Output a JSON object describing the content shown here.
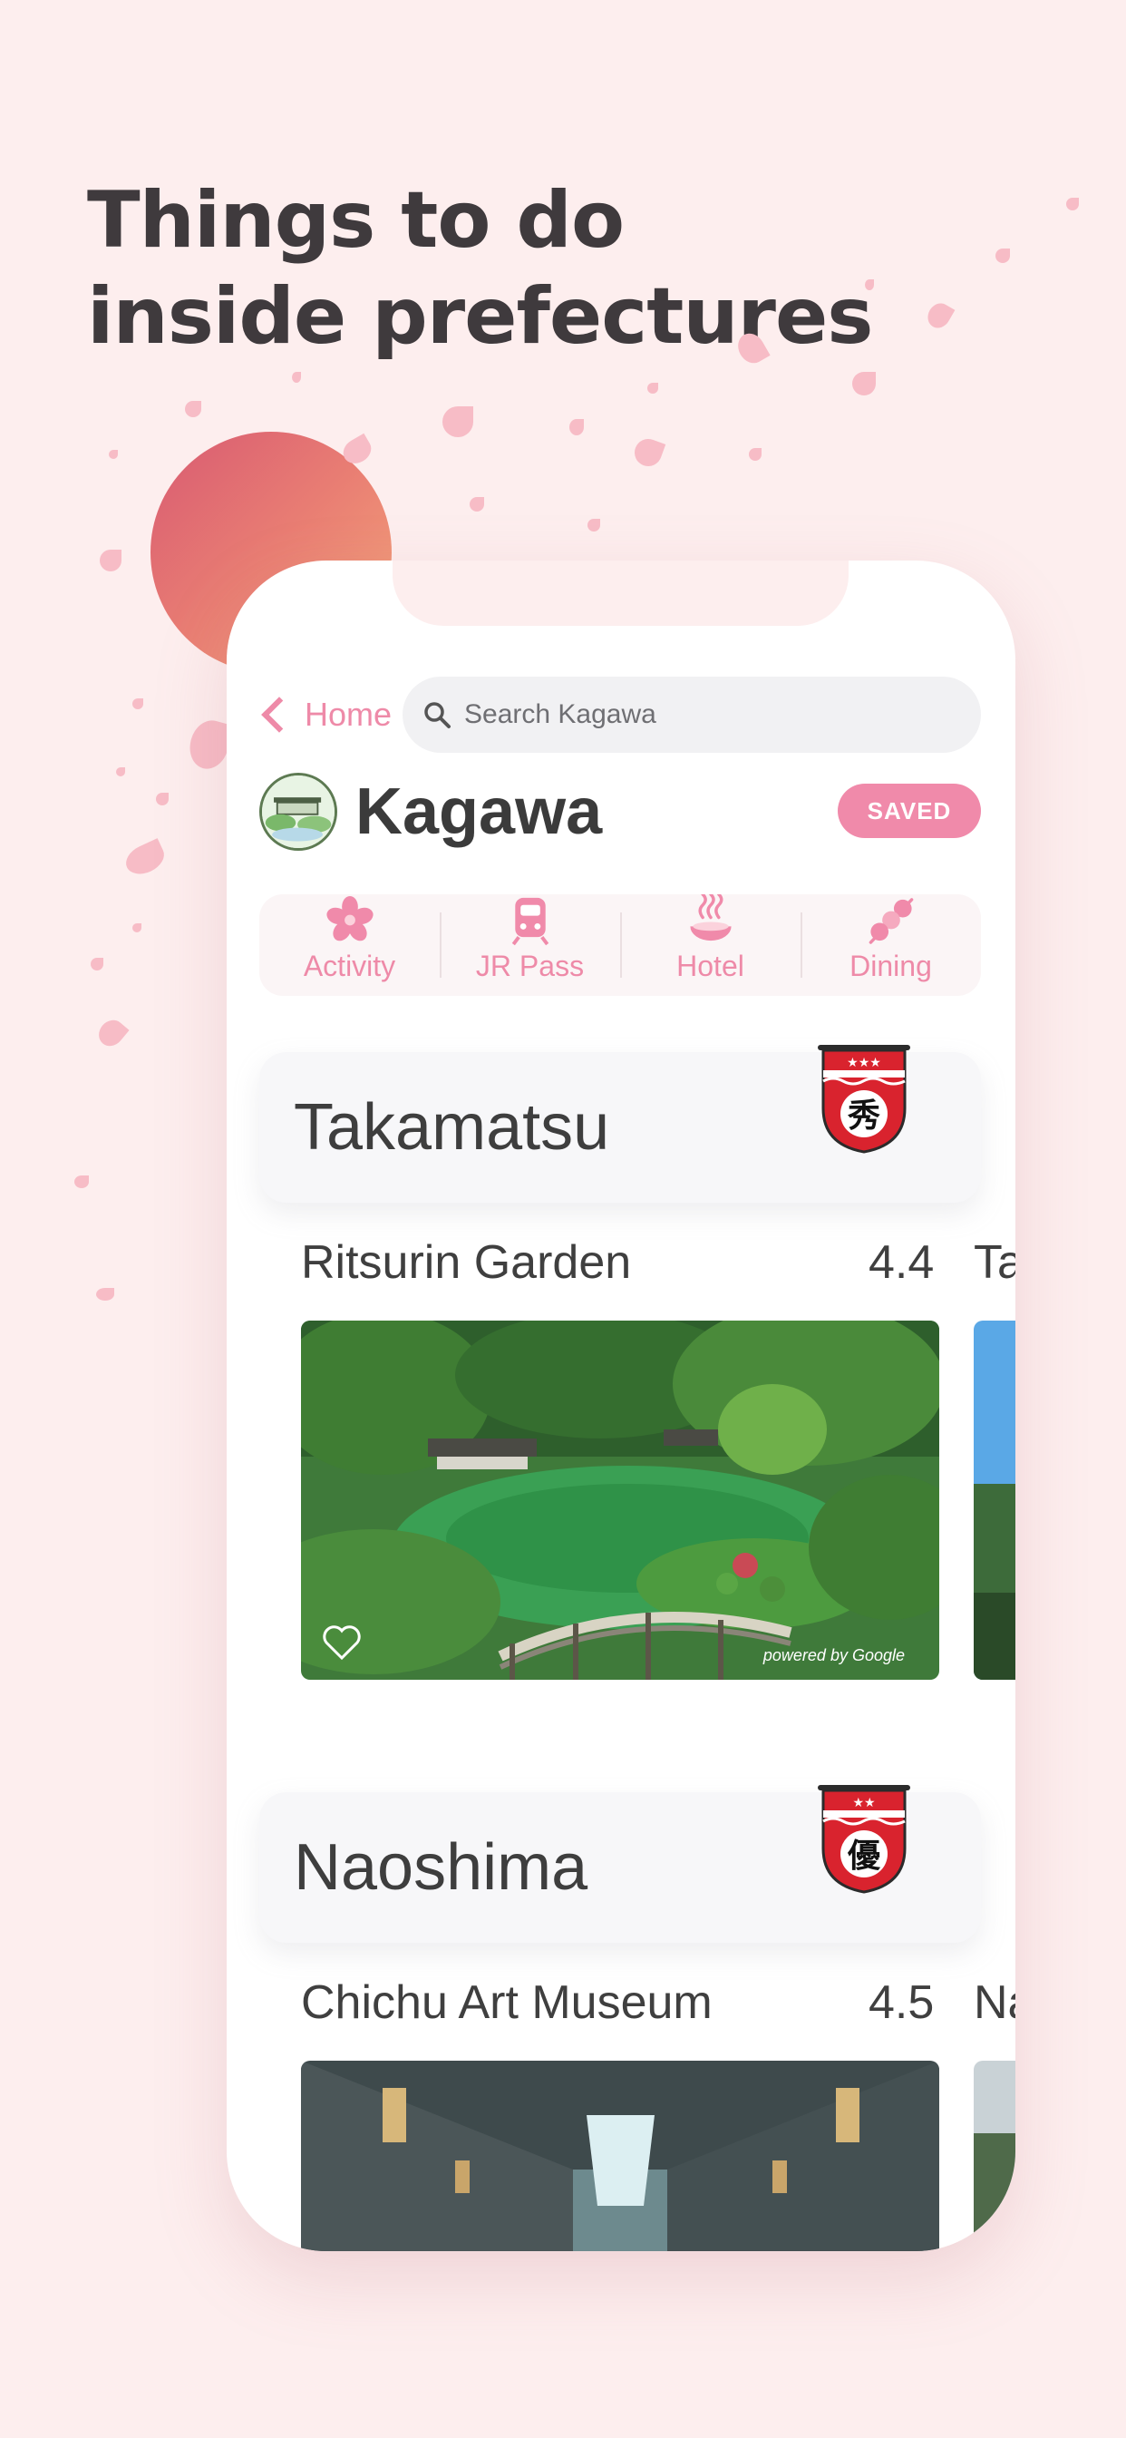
{
  "headline": {
    "line1": "Things to do",
    "line2": "inside prefectures"
  },
  "topbar": {
    "back_label": "Home",
    "search_placeholder": "Search Kagawa"
  },
  "prefecture": {
    "name": "Kagawa",
    "saved_label": "SAVED"
  },
  "categories": [
    {
      "label": "Activity",
      "icon": "cherry-blossom-icon"
    },
    {
      "label": "JR Pass",
      "icon": "train-icon"
    },
    {
      "label": "Hotel",
      "icon": "onsen-icon"
    },
    {
      "label": "Dining",
      "icon": "dango-icon"
    }
  ],
  "sections": [
    {
      "title": "Takamatsu",
      "badge_char": "秀",
      "badge_stars": "★★★",
      "place": {
        "name": "Ritsurin Garden",
        "rating": "4.4",
        "next_name": "Ta",
        "photo_credit": "powered by Google"
      }
    },
    {
      "title": "Naoshima",
      "badge_char": "優",
      "badge_stars": "★★",
      "place": {
        "name": "Chichu Art Museum",
        "rating": "4.5",
        "next_name": "Na"
      }
    }
  ],
  "colors": {
    "background": "#fdeeee",
    "accent_pink": "#ee8aa8",
    "saved_badge": "#f08aaa",
    "badge_red": "#d9232e"
  }
}
